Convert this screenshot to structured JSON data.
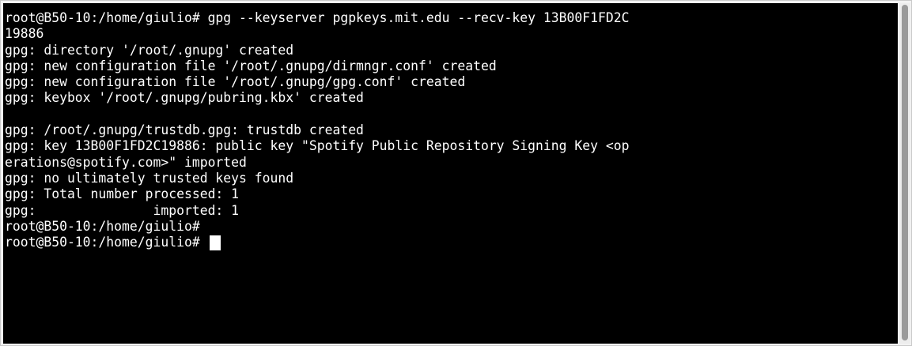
{
  "terminal": {
    "lines": [
      "root@B50-10:/home/giulio# gpg --keyserver pgpkeys.mit.edu --recv-key 13B00F1FD2C",
      "19886",
      "gpg: directory '/root/.gnupg' created",
      "gpg: new configuration file '/root/.gnupg/dirmngr.conf' created",
      "gpg: new configuration file '/root/.gnupg/gpg.conf' created",
      "gpg: keybox '/root/.gnupg/pubring.kbx' created",
      "",
      "gpg: /root/.gnupg/trustdb.gpg: trustdb created",
      "gpg: key 13B00F1FD2C19886: public key \"Spotify Public Repository Signing Key <op",
      "erations@spotify.com>\" imported",
      "gpg: no ultimately trusted keys found",
      "gpg: Total number processed: 1",
      "gpg:               imported: 1",
      "root@B50-10:/home/giulio#",
      "root@B50-10:/home/giulio# "
    ],
    "colors": {
      "background": "#000000",
      "foreground": "#ffffff"
    }
  }
}
